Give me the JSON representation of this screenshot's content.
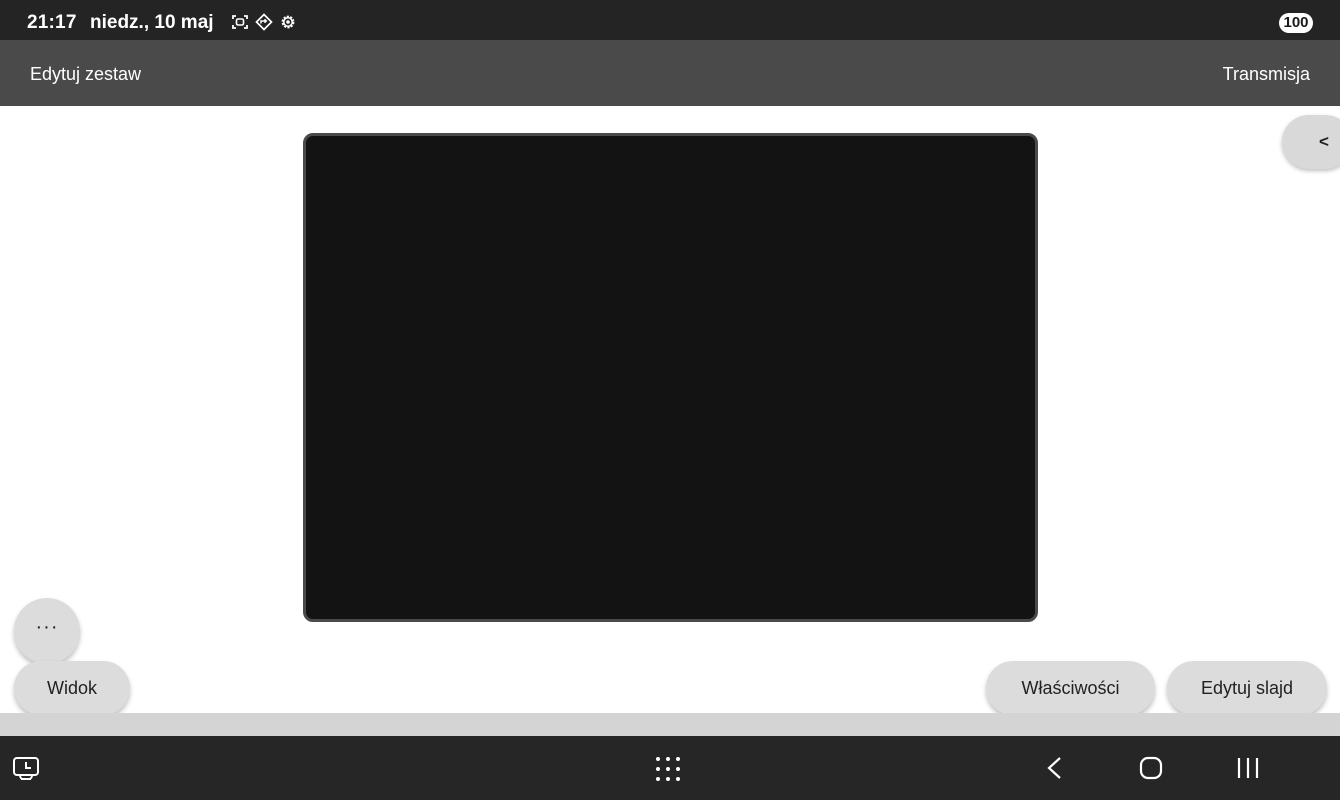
{
  "status_bar": {
    "time": "21:17",
    "date": "niedz., 10 maj",
    "icons": [
      "screenshot-icon",
      "location-diamond-icon",
      "settings-gear-icon"
    ],
    "battery": "100"
  },
  "app_bar": {
    "left_label": "Edytuj zestaw",
    "right_label": "Transmisja"
  },
  "slide_preview": {
    "background_color": "#131313"
  },
  "side_tab": {
    "label": "<"
  },
  "floating_buttons": {
    "more_label": "···",
    "view_label": "Widok",
    "properties_label": "Właściwości",
    "edit_slide_label": "Edytuj slajd"
  },
  "nav_bar": {
    "icons": [
      "recent-screen-icon",
      "app-drawer-icon",
      "back-icon",
      "home-icon",
      "recents-icon"
    ]
  },
  "colors": {
    "status_bar": "#242424",
    "app_bar": "#4a4a4a",
    "nav_bar": "#262626",
    "button": "#dcdcdc"
  }
}
